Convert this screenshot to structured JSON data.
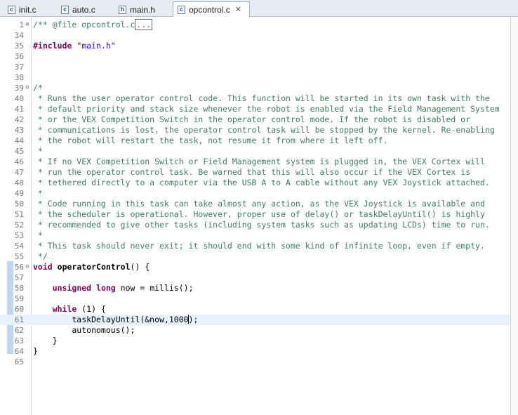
{
  "tabs": [
    {
      "label": "init.c",
      "icon": "c-file-icon",
      "active": false,
      "closable": false
    },
    {
      "label": "auto.c",
      "icon": "c-file-icon",
      "active": false,
      "closable": false
    },
    {
      "label": "main.h",
      "icon": "h-file-icon",
      "active": false,
      "closable": false
    },
    {
      "label": "opcontrol.c",
      "icon": "c-file-icon",
      "active": true,
      "closable": true
    }
  ],
  "icon_glyphs": {
    "c": "c",
    "h": "h",
    "close": "✕"
  },
  "editor": {
    "lines": [
      {
        "num": "1",
        "fold": "⊕",
        "segments": [
          {
            "t": "/** @file opcontrol.c",
            "c": "comment"
          },
          {
            "t": "...",
            "c": "comment box"
          }
        ]
      },
      {
        "num": "34",
        "segments": []
      },
      {
        "num": "35",
        "segments": [
          {
            "t": "#include",
            "c": "pp"
          },
          {
            "t": " ",
            "c": ""
          },
          {
            "t": "\"main.h\"",
            "c": "str"
          }
        ]
      },
      {
        "num": "36",
        "segments": []
      },
      {
        "num": "37",
        "segments": []
      },
      {
        "num": "38",
        "segments": []
      },
      {
        "num": "39",
        "fold": "⊖",
        "segments": [
          {
            "t": "/*",
            "c": "comment"
          }
        ]
      },
      {
        "num": "40",
        "segments": [
          {
            "t": " * Runs the user operator control code. This function will be started in its own task with the",
            "c": "comment"
          }
        ]
      },
      {
        "num": "41",
        "segments": [
          {
            "t": " * default priority and stack size whenever the robot is enabled via the Field Management System",
            "c": "comment"
          }
        ]
      },
      {
        "num": "42",
        "segments": [
          {
            "t": " * or the VEX Competition Switch in the operator control mode. If the robot is disabled or",
            "c": "comment"
          }
        ]
      },
      {
        "num": "43",
        "segments": [
          {
            "t": " * communications is lost, the operator control task will be stopped by the kernel. Re-enabling",
            "c": "comment"
          }
        ]
      },
      {
        "num": "44",
        "segments": [
          {
            "t": " * the robot will restart the task, not resume it from where it left off.",
            "c": "comment"
          }
        ]
      },
      {
        "num": "45",
        "segments": [
          {
            "t": " *",
            "c": "comment"
          }
        ]
      },
      {
        "num": "46",
        "segments": [
          {
            "t": " * If no VEX Competition Switch or Field Management system is plugged in, the VEX Cortex will",
            "c": "comment"
          }
        ]
      },
      {
        "num": "47",
        "segments": [
          {
            "t": " * run the operator control task. Be warned that this will also occur if the VEX Cortex is",
            "c": "comment"
          }
        ]
      },
      {
        "num": "48",
        "segments": [
          {
            "t": " * tethered directly to a computer via the USB A to A cable without any VEX Joystick attached.",
            "c": "comment"
          }
        ]
      },
      {
        "num": "49",
        "segments": [
          {
            "t": " *",
            "c": "comment"
          }
        ]
      },
      {
        "num": "50",
        "segments": [
          {
            "t": " * Code running in this task can take almost any action, as the VEX Joystick is available and",
            "c": "comment"
          }
        ]
      },
      {
        "num": "51",
        "segments": [
          {
            "t": " * the scheduler is operational. However, proper use of delay() or taskDelayUntil() is highly",
            "c": "comment"
          }
        ]
      },
      {
        "num": "52",
        "segments": [
          {
            "t": " * recommended to give other tasks (including system tasks such as updating LCDs) time to run.",
            "c": "comment"
          }
        ]
      },
      {
        "num": "53",
        "segments": [
          {
            "t": " *",
            "c": "comment"
          }
        ]
      },
      {
        "num": "54",
        "segments": [
          {
            "t": " * This task should never exit; it should end with some kind of infinite loop, even if empty.",
            "c": "comment"
          }
        ]
      },
      {
        "num": "55",
        "segments": [
          {
            "t": " */",
            "c": "comment"
          }
        ]
      },
      {
        "num": "56",
        "fold": "⊖",
        "segments": [
          {
            "t": "void",
            "c": "kw"
          },
          {
            "t": " ",
            "c": ""
          },
          {
            "t": "operatorControl",
            "c": "fn"
          },
          {
            "t": "() {",
            "c": ""
          }
        ]
      },
      {
        "num": "57",
        "segments": []
      },
      {
        "num": "58",
        "segments": [
          {
            "t": "    ",
            "c": ""
          },
          {
            "t": "unsigned",
            "c": "kw"
          },
          {
            "t": " ",
            "c": ""
          },
          {
            "t": "long",
            "c": "kw"
          },
          {
            "t": " now = millis();",
            "c": ""
          }
        ]
      },
      {
        "num": "59",
        "segments": []
      },
      {
        "num": "60",
        "segments": [
          {
            "t": "    ",
            "c": ""
          },
          {
            "t": "while",
            "c": "kw"
          },
          {
            "t": " (1) {",
            "c": ""
          }
        ]
      },
      {
        "num": "61",
        "current": true,
        "segments": [
          {
            "t": "        taskDelayUntil(&now,1000",
            "c": ""
          },
          {
            "t": "",
            "c": "caret"
          },
          {
            "t": ");",
            "c": ""
          }
        ]
      },
      {
        "num": "62",
        "segments": [
          {
            "t": "        autonomous();",
            "c": ""
          }
        ]
      },
      {
        "num": "63",
        "segments": [
          {
            "t": "    }",
            "c": ""
          }
        ]
      },
      {
        "num": "64",
        "segments": [
          {
            "t": "}",
            "c": ""
          }
        ]
      },
      {
        "num": "65",
        "segments": []
      }
    ]
  }
}
